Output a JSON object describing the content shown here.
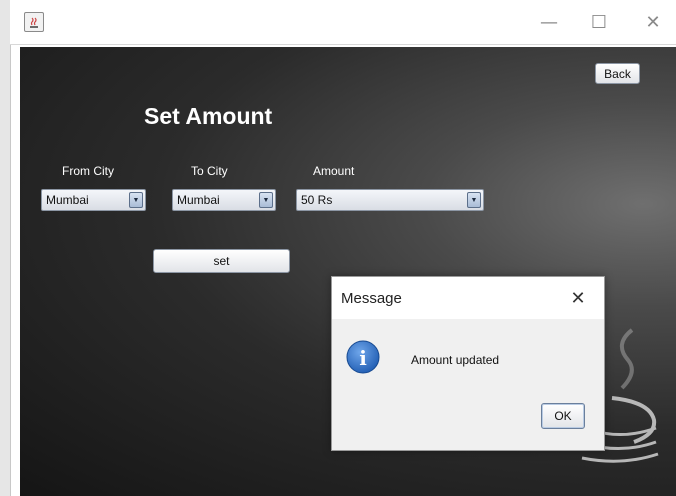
{
  "window": {
    "minimize_glyph": "—",
    "maximize_glyph": "☐",
    "close_glyph": "✕"
  },
  "header": {
    "back_label": "Back",
    "title": "Set Amount"
  },
  "form": {
    "from_city": {
      "label": "From City",
      "value": "Mumbai"
    },
    "to_city": {
      "label": "To City",
      "value": "Mumbai"
    },
    "amount": {
      "label": "Amount",
      "value": "50 Rs"
    },
    "dropdown_glyph": "▼",
    "set_label": "set"
  },
  "dialog": {
    "title": "Message",
    "close_glyph": "✕",
    "message": "Amount updated",
    "ok_label": "OK",
    "icon": "info-icon",
    "icon_letter": "i"
  },
  "colors": {
    "background_dark": "#151515",
    "background_light": "#6f6f6f",
    "info_blue": "#2e6fc4"
  }
}
